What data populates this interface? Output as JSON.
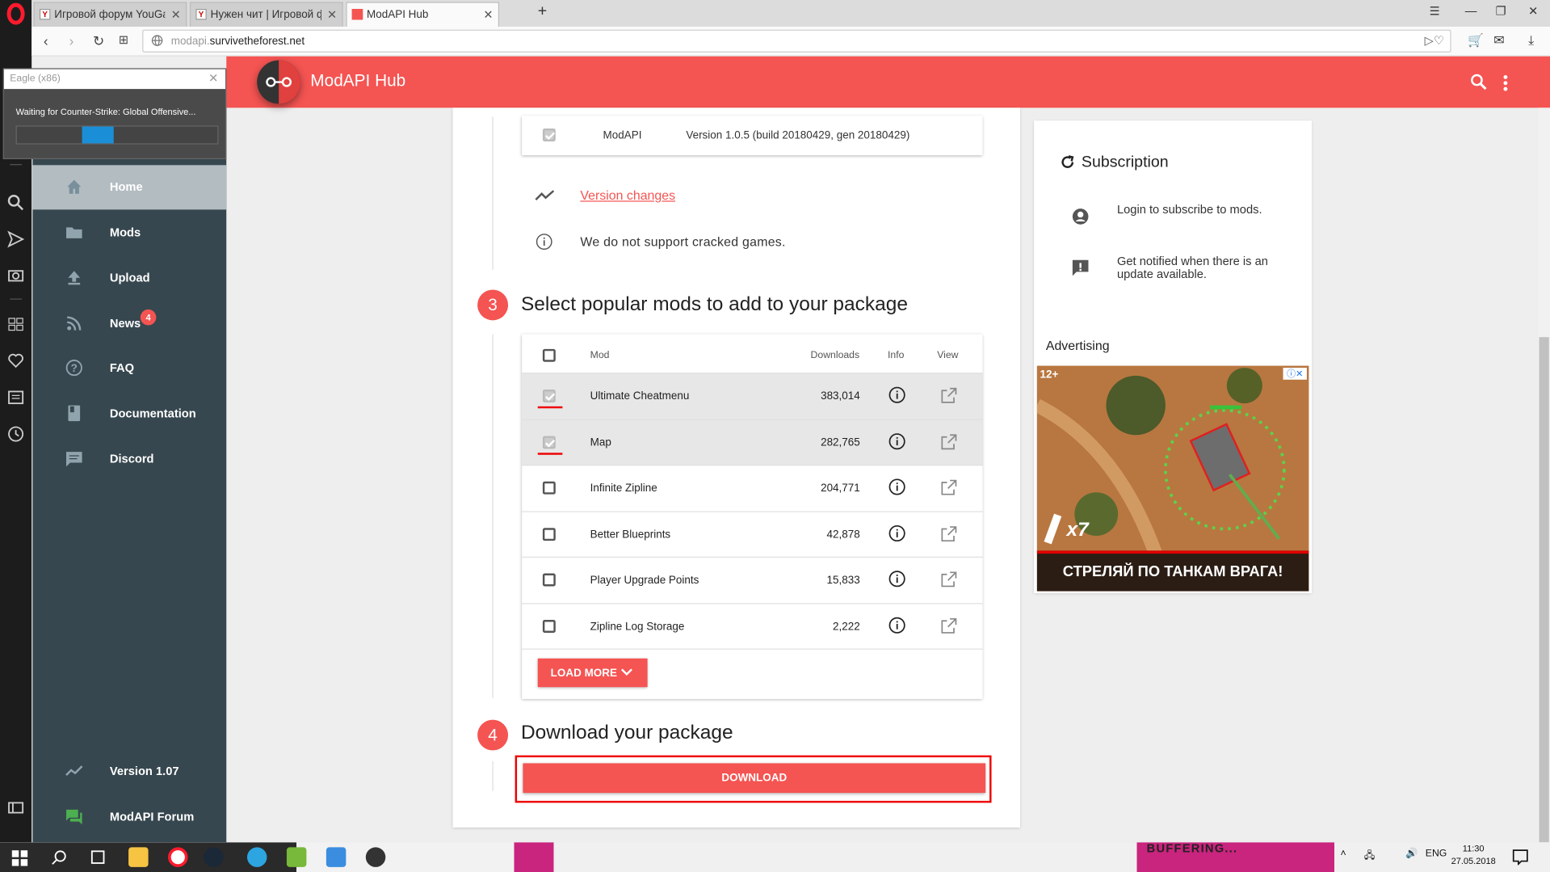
{
  "browser": {
    "tabs": [
      {
        "title": "Игровой форум YouGame.Biz",
        "favicon": "Y"
      },
      {
        "title": "Нужен чит | Игровой форум",
        "favicon": "Y"
      },
      {
        "title": "ModAPI Hub",
        "favicon": ""
      }
    ],
    "url_host": "modapi.",
    "url_domain": "survivetheforest.net"
  },
  "eagle": {
    "title": "Eagle (x86)",
    "message": "Waiting for Counter-Strike: Global Offensive...",
    "progress": 0.16
  },
  "app": {
    "title": "ModAPI Hub",
    "accent": "#f45452",
    "sidebar_bg": "#37474f",
    "nav": [
      {
        "label": "Home",
        "icon": "home-icon"
      },
      {
        "label": "Mods",
        "icon": "folder-icon"
      },
      {
        "label": "Upload",
        "icon": "upload-icon"
      },
      {
        "label": "News",
        "icon": "rss-icon",
        "badge": "4"
      },
      {
        "label": "FAQ",
        "icon": "help-icon"
      },
      {
        "label": "Documentation",
        "icon": "book-icon"
      },
      {
        "label": "Discord",
        "icon": "chat-icon"
      }
    ],
    "nav_bottom": [
      {
        "label": "Version 1.07",
        "icon": "trend-icon"
      },
      {
        "label": "ModAPI Forum",
        "icon": "forum-icon"
      }
    ]
  },
  "main": {
    "modapi_row": {
      "name": "ModAPI",
      "version": "Version 1.0.5 (build 20180429, gen 20180429)"
    },
    "version_changes": "Version changes",
    "no_support": "We do not support cracked games.",
    "step3": {
      "number": "3",
      "title": "Select popular mods to add to your package"
    },
    "table": {
      "headers": {
        "mod": "Mod",
        "downloads": "Downloads",
        "info": "Info",
        "view": "View"
      },
      "rows": [
        {
          "name": "Ultimate Cheatmenu",
          "downloads": "383,014",
          "checked": true
        },
        {
          "name": "Map",
          "downloads": "282,765",
          "checked": true
        },
        {
          "name": "Infinite Zipline",
          "downloads": "204,771",
          "checked": false
        },
        {
          "name": "Better Blueprints",
          "downloads": "42,878",
          "checked": false
        },
        {
          "name": "Player Upgrade Points",
          "downloads": "15,833",
          "checked": false
        },
        {
          "name": "Zipline Log Storage",
          "downloads": "2,222",
          "checked": false
        }
      ],
      "load_more": "LOAD MORE"
    },
    "step4": {
      "number": "4",
      "title": "Download your package"
    },
    "download": "DOWNLOAD"
  },
  "subscription": {
    "title": "Subscription",
    "login_text": "Login to subscribe to mods.",
    "notify_text": "Get notified when there is an update available.",
    "advertising": "Advertising",
    "ad_age": "12+",
    "ad_multiplier": "x7",
    "ad_text": "СТРЕЛЯЙ ПО ТАНКАМ ВРАГА!"
  },
  "taskbar": {
    "buffering": "BUFFERING...",
    "lang": "ENG",
    "time": "11:30",
    "date": "27.05.2018"
  }
}
